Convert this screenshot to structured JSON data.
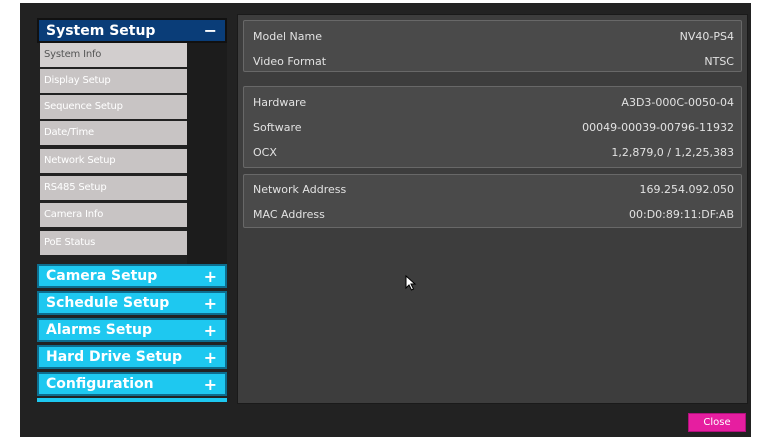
{
  "menu": {
    "active_section": {
      "label": "System Setup",
      "sign": "−"
    },
    "sub_items": [
      "System Info",
      "Display Setup",
      "Sequence Setup",
      "Date/Time",
      "Network Setup",
      "RS485 Setup",
      "Camera Info",
      "PoE Status"
    ],
    "collapsed_sections": [
      {
        "label": "Camera Setup",
        "sign": "+"
      },
      {
        "label": "Schedule Setup",
        "sign": "+"
      },
      {
        "label": "Alarms Setup",
        "sign": "+"
      },
      {
        "label": "Hard Drive Setup",
        "sign": "+"
      },
      {
        "label": "Configuration",
        "sign": "+"
      }
    ]
  },
  "info": {
    "groups": [
      {
        "rows": [
          {
            "label": "Model Name",
            "value": "NV40-PS4"
          },
          {
            "label": "Video Format",
            "value": "NTSC"
          }
        ]
      },
      {
        "rows": [
          {
            "label": "Hardware",
            "value": "A3D3-000C-0050-04"
          },
          {
            "label": "Software",
            "value": "00049-00039-00796-11932"
          },
          {
            "label": "OCX",
            "value": "1,2,879,0 / 1,2,25,383"
          }
        ]
      },
      {
        "rows": [
          {
            "label": "Network Address",
            "value": "169.254.092.050"
          },
          {
            "label": "MAC Address",
            "value": "00:D0:89:11:DF:AB"
          }
        ]
      }
    ]
  },
  "buttons": {
    "close": "Close"
  },
  "colors": {
    "active_header": "#0a3d78",
    "collapsed_header": "#1ec8f0",
    "close_button": "#e61ea0"
  }
}
